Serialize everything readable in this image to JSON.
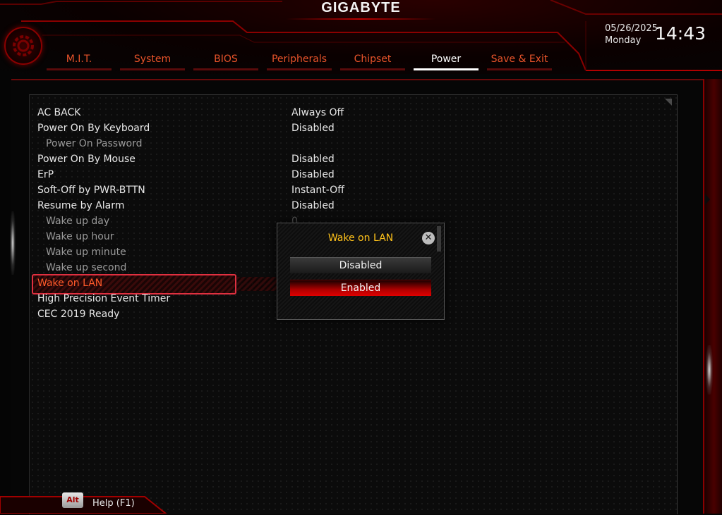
{
  "brand": "GIGABYTE",
  "datetime": {
    "date": "05/26/2025",
    "day": "Monday",
    "time": "14:43"
  },
  "tabs": [
    {
      "label": "M.I.T.",
      "active": false
    },
    {
      "label": "System",
      "active": false
    },
    {
      "label": "BIOS",
      "active": false
    },
    {
      "label": "Peripherals",
      "active": false
    },
    {
      "label": "Chipset",
      "active": false
    },
    {
      "label": "Power",
      "active": true
    },
    {
      "label": "Save & Exit",
      "active": false
    }
  ],
  "settings": [
    {
      "label": "AC BACK",
      "value": "Always Off"
    },
    {
      "label": "Power On By Keyboard",
      "value": "Disabled"
    },
    {
      "label": "Power On Password",
      "value": ""
    },
    {
      "label": "Power On By Mouse",
      "value": "Disabled"
    },
    {
      "label": "ErP",
      "value": "Disabled"
    },
    {
      "label": "Soft-Off by PWR-BTTN",
      "value": "Instant-Off"
    },
    {
      "label": "Resume by Alarm",
      "value": "Disabled"
    },
    {
      "label": "Wake up day",
      "value": "0"
    },
    {
      "label": "Wake up hour",
      "value": ""
    },
    {
      "label": "Wake up minute",
      "value": ""
    },
    {
      "label": "Wake up second",
      "value": ""
    },
    {
      "label": "Wake on LAN",
      "value": ""
    },
    {
      "label": "High Precision Event Timer",
      "value": ""
    },
    {
      "label": "CEC 2019 Ready",
      "value": ""
    }
  ],
  "popup": {
    "title": "Wake on LAN",
    "options": [
      "Disabled",
      "Enabled"
    ],
    "selected": "Enabled"
  },
  "footer": {
    "key": "Alt",
    "help": "Help (F1)"
  },
  "colors": {
    "accent_red": "#c00000",
    "tab_text": "#e8532a",
    "selected_text": "#ff5a2a",
    "popup_title": "#ffc21a",
    "highlight_border": "#e03040"
  },
  "icons": [
    "gear-icon",
    "close-icon",
    "chevron-right-icon"
  ]
}
